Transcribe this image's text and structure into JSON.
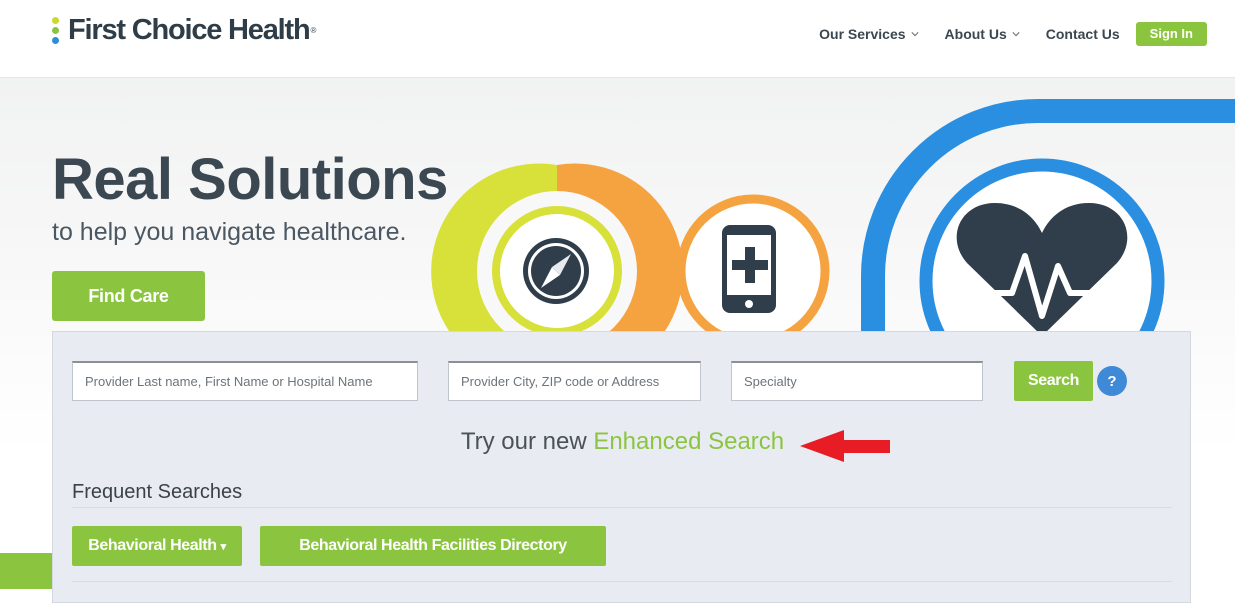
{
  "brand": {
    "name": "First Choice Health",
    "registered_mark": "®",
    "dot_colors": [
      "#c9da2a",
      "#8bc53f",
      "#2a8fd8"
    ]
  },
  "nav": {
    "items": [
      {
        "label": "Our Services",
        "has_dropdown": true
      },
      {
        "label": "About Us",
        "has_dropdown": true
      },
      {
        "label": "Contact Us",
        "has_dropdown": false
      }
    ],
    "sign_in": "Sign In"
  },
  "hero": {
    "headline": "Real Solutions",
    "subhead": "to help you navigate healthcare.",
    "find_care": "Find Care",
    "icons": [
      "compass-icon",
      "mobile-health-icon",
      "heartbeat-icon"
    ]
  },
  "search": {
    "provider_placeholder": "Provider Last name, First Name or Hospital Name",
    "location_placeholder": "Provider City, ZIP code or Address",
    "specialty_placeholder": "Specialty",
    "search_button": "Search",
    "help_button": "?",
    "try_prefix": "Try our new",
    "enhanced_link": "Enhanced Search"
  },
  "frequent": {
    "title": "Frequent Searches",
    "items": [
      {
        "label": "Behavioral Health",
        "caret": "▾"
      },
      {
        "label": "Behavioral Health Facilities Directory"
      }
    ]
  },
  "colors": {
    "brand_green": "#8bc53f",
    "lime": "#d8e03a",
    "orange": "#f4a340",
    "blue": "#2a8fe0",
    "dark_slate": "#2f3e4a",
    "arrow_red": "#e81c24"
  }
}
